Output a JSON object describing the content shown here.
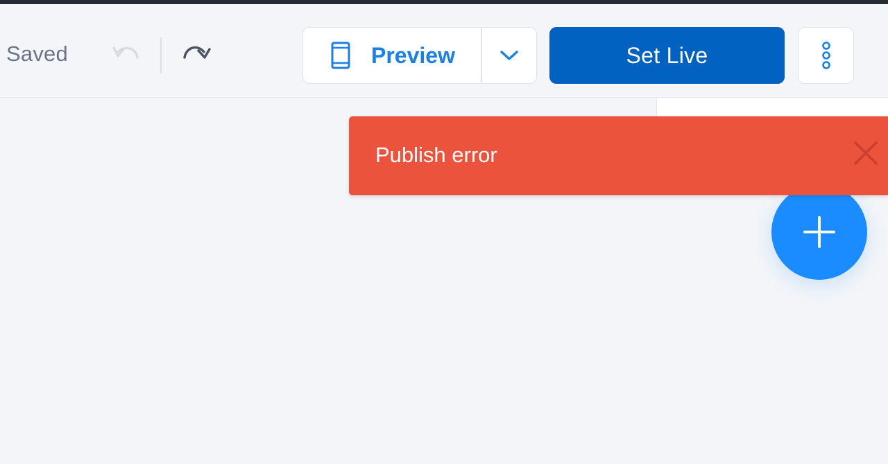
{
  "toolbar": {
    "status_text": "Saved",
    "undo_icon": "undo-icon",
    "redo_icon": "redo-icon",
    "preview_label": "Preview",
    "preview_icon": "mobile-device-icon",
    "preview_dropdown_icon": "chevron-down-icon",
    "set_live_label": "Set Live",
    "more_icon": "vertical-dots-icon"
  },
  "toast": {
    "message": "Publish error",
    "close_icon": "close-icon",
    "color": "#eb533c"
  },
  "fab": {
    "icon": "plus-icon",
    "color": "#1a8cff"
  },
  "colors": {
    "accent": "#1880e8",
    "primary_button": "#0262c2",
    "background": "#f3f5f8"
  }
}
